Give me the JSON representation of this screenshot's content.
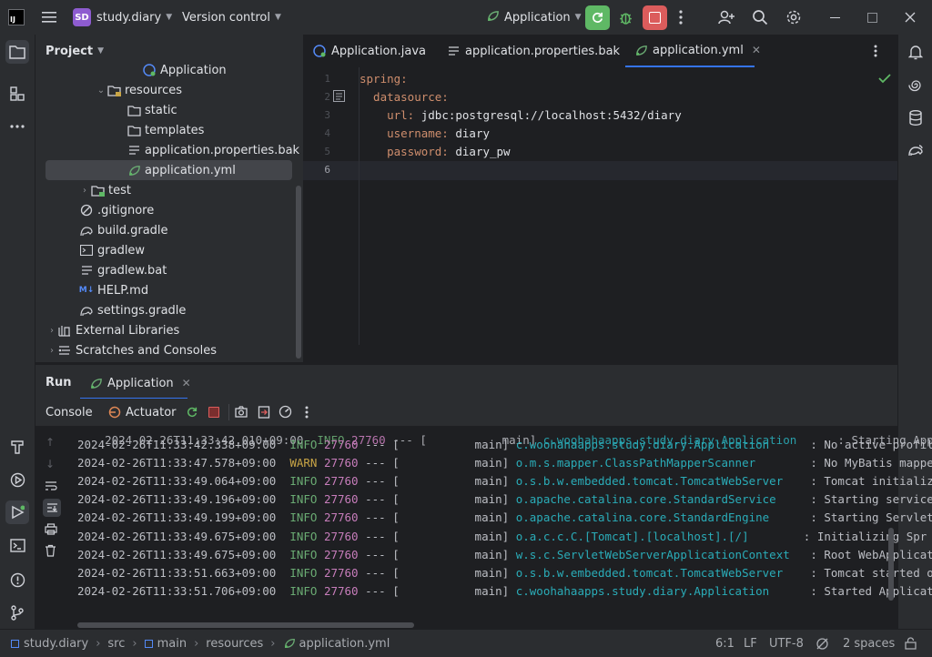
{
  "titlebar": {
    "app_logo": "IJ",
    "project_badge": "SD",
    "project_name": "study.diary",
    "vcs_label": "Version control",
    "run_config": "Application"
  },
  "project_panel": {
    "title": "Project",
    "items": [
      {
        "label": "Application",
        "icon": "spring-class-icon"
      },
      {
        "label": "resources",
        "icon": "folder-icon"
      },
      {
        "label": "static",
        "icon": "folder-icon"
      },
      {
        "label": "templates",
        "icon": "folder-icon"
      },
      {
        "label": "application.properties.bak",
        "icon": "text-file-icon"
      },
      {
        "label": "application.yml",
        "icon": "yml-icon"
      },
      {
        "label": "test",
        "icon": "folder-icon"
      },
      {
        "label": ".gitignore",
        "icon": "ignore-icon"
      },
      {
        "label": "build.gradle",
        "icon": "gradle-icon"
      },
      {
        "label": "gradlew",
        "icon": "terminal-file-icon"
      },
      {
        "label": "gradlew.bat",
        "icon": "text-file-icon"
      },
      {
        "label": "HELP.md",
        "icon": "markdown-icon"
      },
      {
        "label": "settings.gradle",
        "icon": "gradle-icon"
      },
      {
        "label": "External Libraries",
        "icon": "library-icon"
      },
      {
        "label": "Scratches and Consoles",
        "icon": "scratches-icon"
      }
    ]
  },
  "editor": {
    "tabs": [
      {
        "label": "Application.java"
      },
      {
        "label": "application.properties.bak"
      },
      {
        "label": "application.yml"
      }
    ],
    "line_numbers": [
      "1",
      "2",
      "3",
      "4",
      "5",
      "6"
    ],
    "lines": [
      {
        "key": "spring:",
        "value": ""
      },
      {
        "key": "  datasource:",
        "value": ""
      },
      {
        "key": "    url:",
        "value": " jdbc:postgresql://localhost:5432/diary"
      },
      {
        "key": "    username:",
        "value": " diary"
      },
      {
        "key": "    password:",
        "value": " diary_pw"
      },
      {
        "key": "",
        "value": ""
      }
    ]
  },
  "run_panel": {
    "title": "Run",
    "tab_label": "Application",
    "console_tab": "Console",
    "actuator_tab": "Actuator",
    "logs": [
      {
        "ts": "2024-02-26T11:33:42.338+09:00",
        "level": "INFO",
        "pid": "27760",
        "sep": "--- [",
        "thread": "           main]",
        "cls": "c.woohahaapps.study.diary.Application     ",
        "msg": " : No active profil"
      },
      {
        "ts": "2024-02-26T11:33:47.578+09:00",
        "level": "WARN",
        "pid": "27760",
        "sep": "--- [",
        "thread": "           main]",
        "cls": "o.m.s.mapper.ClassPathMapperScanner       ",
        "msg": " : No MyBatis mappe"
      },
      {
        "ts": "2024-02-26T11:33:49.064+09:00",
        "level": "INFO",
        "pid": "27760",
        "sep": "--- [",
        "thread": "           main]",
        "cls": "o.s.b.w.embedded.tomcat.TomcatWebServer   ",
        "msg": " : Tomcat initializ"
      },
      {
        "ts": "2024-02-26T11:33:49.196+09:00",
        "level": "INFO",
        "pid": "27760",
        "sep": "--- [",
        "thread": "           main]",
        "cls": "o.apache.catalina.core.StandardService    ",
        "msg": " : Starting service"
      },
      {
        "ts": "2024-02-26T11:33:49.199+09:00",
        "level": "INFO",
        "pid": "27760",
        "sep": "--- [",
        "thread": "           main]",
        "cls": "o.apache.catalina.core.StandardEngine     ",
        "msg": " : Starting Servlet"
      },
      {
        "ts": "2024-02-26T11:33:49.675+09:00",
        "level": "INFO",
        "pid": "27760",
        "sep": "--- [",
        "thread": "           main]",
        "cls": "o.a.c.c.C.[Tomcat].[localhost].[/]       ",
        "msg": " : Initializing Spr"
      },
      {
        "ts": "2024-02-26T11:33:49.675+09:00",
        "level": "INFO",
        "pid": "27760",
        "sep": "--- [",
        "thread": "           main]",
        "cls": "w.s.c.ServletWebServerApplicationContext  ",
        "msg": " : Root WebApplicat"
      },
      {
        "ts": "2024-02-26T11:33:51.663+09:00",
        "level": "INFO",
        "pid": "27760",
        "sep": "--- [",
        "thread": "           main]",
        "cls": "o.s.b.w.embedded.tomcat.TomcatWebServer   ",
        "msg": " : Tomcat started o"
      },
      {
        "ts": "2024-02-26T11:33:51.706+09:00",
        "level": "INFO",
        "pid": "27760",
        "sep": "--- [",
        "thread": "           main]",
        "cls": "c.woohahaapps.study.diary.Application     ",
        "msg": " : Started Applicat"
      }
    ]
  },
  "statusbar": {
    "breadcrumbs": [
      "study.diary",
      "src",
      "main",
      "resources",
      "application.yml"
    ],
    "position": "6:1",
    "line_sep": "LF",
    "encoding": "UTF-8",
    "indent": "2 spaces"
  },
  "colors": {
    "accent": "#3574f0",
    "run_green": "#5fb865",
    "stop_red": "#db5c5c",
    "badge": "#8e5cd0"
  }
}
